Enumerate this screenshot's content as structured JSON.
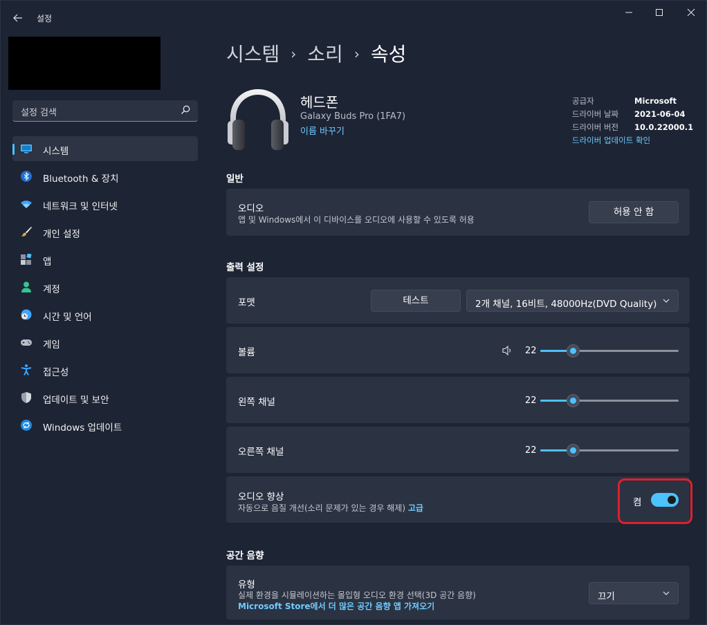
{
  "window": {
    "title": "설정",
    "controls": {
      "minimize": "—",
      "maximize": "□",
      "close": "✕"
    }
  },
  "sidebar": {
    "search_placeholder": "설정 검색",
    "items": [
      {
        "label": "시스템",
        "icon": "system-monitor-icon",
        "active": true
      },
      {
        "label": "Bluetooth & 장치",
        "icon": "bluetooth-icon"
      },
      {
        "label": "네트워크 및 인터넷",
        "icon": "wifi-icon"
      },
      {
        "label": "개인 설정",
        "icon": "brush-icon"
      },
      {
        "label": "앱",
        "icon": "apps-icon"
      },
      {
        "label": "계정",
        "icon": "person-icon"
      },
      {
        "label": "시간 및 언어",
        "icon": "clock-globe-icon"
      },
      {
        "label": "게임",
        "icon": "gamepad-icon"
      },
      {
        "label": "접근성",
        "icon": "accessibility-icon"
      },
      {
        "label": "업데이트 및 보안",
        "icon": "shield-icon"
      },
      {
        "label": "Windows 업데이트",
        "icon": "windows-update-icon"
      }
    ]
  },
  "breadcrumb": {
    "level1": "시스템",
    "level2": "소리",
    "current": "속성",
    "separator": "›"
  },
  "device": {
    "name": "헤드폰",
    "model": "Galaxy Buds Pro (1FA7)",
    "rename_link": "이름 바꾸기",
    "meta": [
      {
        "key": "공급자",
        "value": "Microsoft"
      },
      {
        "key": "드라이버 날짜",
        "value": "2021-06-04"
      },
      {
        "key": "드라이버 버전",
        "value": "10.0.22000.1"
      }
    ],
    "driver_update_link": "드라이버 업데이트 확인"
  },
  "general": {
    "section_title": "일반",
    "audio": {
      "title": "오디오",
      "subtitle": "앱 및 Windows에서 이 디바이스를 오디오에 사용할 수 있도록 허용",
      "button": "허용 안 함"
    }
  },
  "output": {
    "section_title": "출력 설정",
    "format": {
      "title": "포맷",
      "test_button": "테스트",
      "selected": "2개 채널, 16비트, 48000Hz(DVD Quality)"
    },
    "volume": {
      "title": "볼륨",
      "value": "22",
      "level": 0.22
    },
    "left": {
      "title": "왼쪽 채널",
      "value": "22",
      "level": 0.22
    },
    "right": {
      "title": "오른쪽 채널",
      "value": "22",
      "level": 0.22
    },
    "enhance": {
      "title": "오디오 향상",
      "subtitle": "자동으로 음질 개선(소리 문제가 있는 경우 해제)",
      "link": "고급",
      "toggle_label": "켬",
      "on": true
    }
  },
  "spatial": {
    "section_title": "공간 음향",
    "type": {
      "title": "유형",
      "subtitle": "실제 환경을 시뮬레이션하는 몰입형 오디오 환경 선택(3D 공간 음향)",
      "link": "Microsoft Store에서 더 많은 공간 음향 앱 가져오기",
      "selected": "끄기"
    }
  },
  "colors": {
    "accent": "#4cc2ff",
    "background": "#1d2434",
    "card": "#2b3242",
    "highlight": "#e0202a"
  }
}
